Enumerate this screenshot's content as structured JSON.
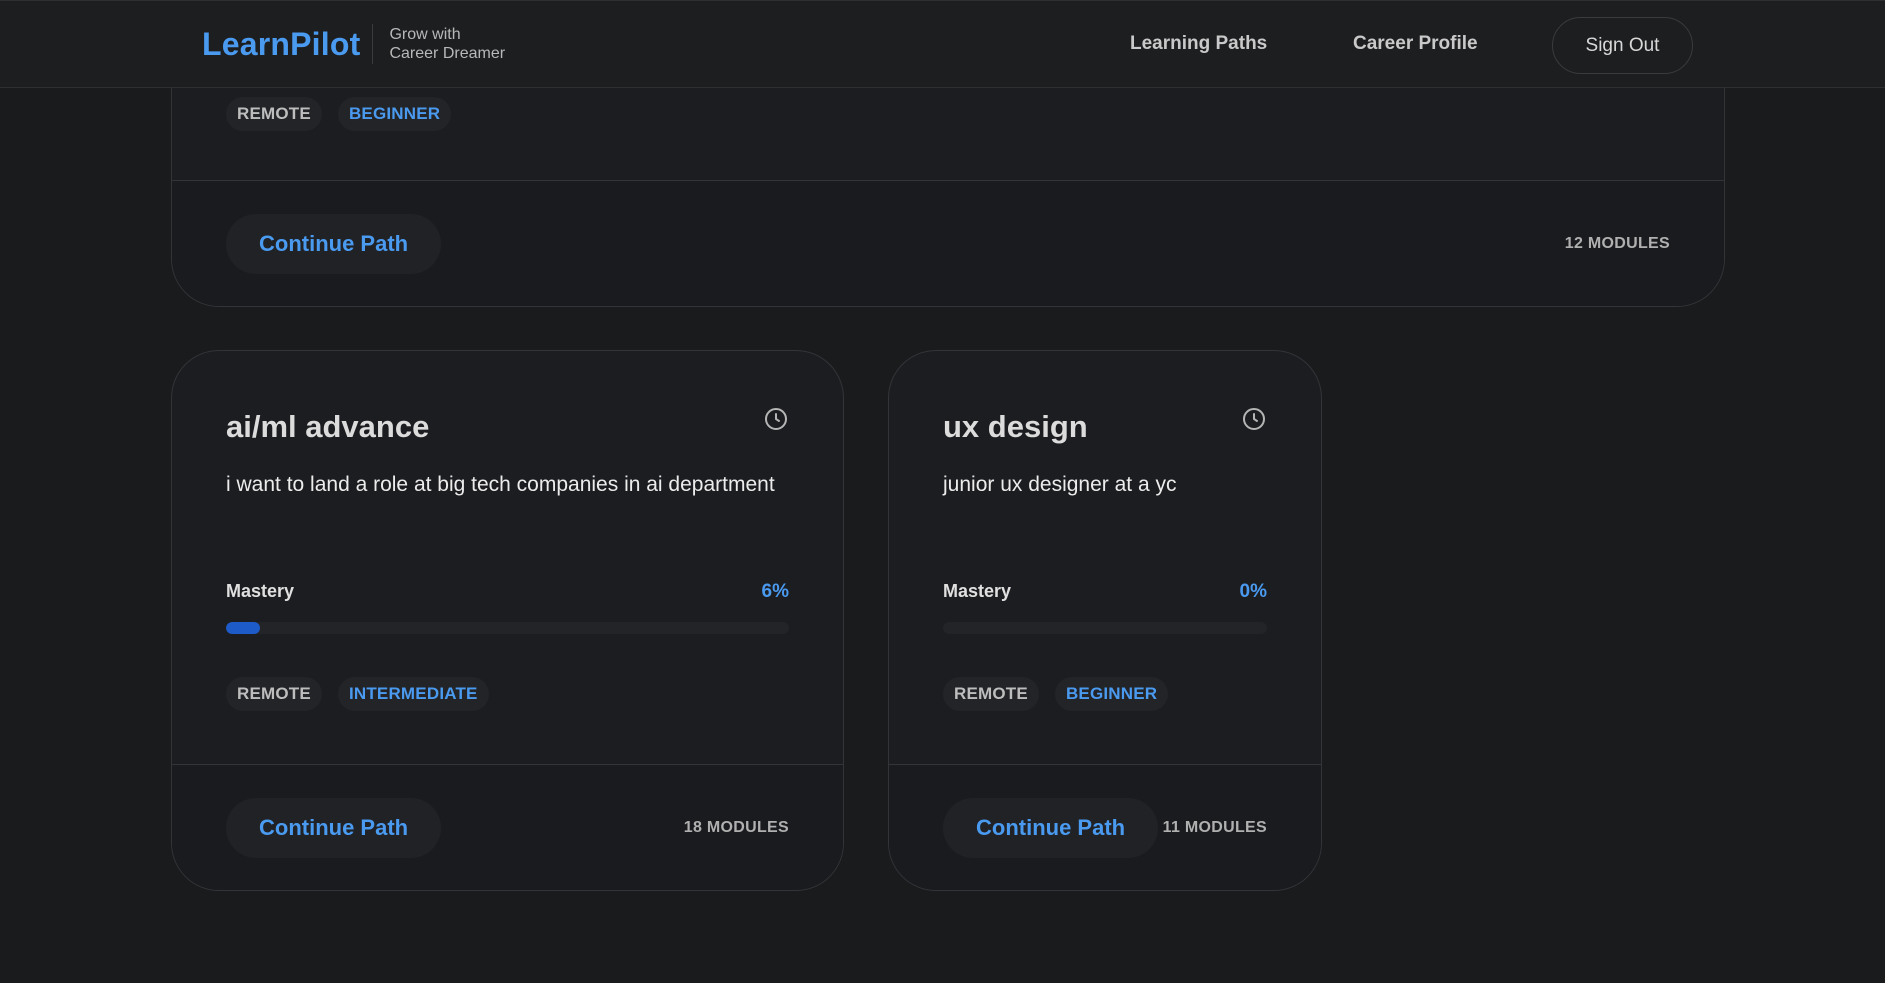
{
  "header": {
    "brand": "LearnPilot",
    "tagline_line1": "Grow with",
    "tagline_line2": "Career Dreamer",
    "nav": [
      "Learning Paths",
      "Career Profile"
    ],
    "sign_out": "Sign Out"
  },
  "cards": [
    {
      "tags": [
        "REMOTE",
        "BEGINNER"
      ],
      "cta": "Continue Path",
      "modules": "12 MODULES"
    },
    {
      "title": "ai/ml advance",
      "description": "i want to land a role at big tech companies in ai department",
      "mastery_label": "Mastery",
      "mastery_percent_text": "6%",
      "mastery_fraction": 0.06,
      "tags": [
        "REMOTE",
        "INTERMEDIATE"
      ],
      "cta": "Continue Path",
      "modules": "18 MODULES",
      "icon": "clock-icon"
    },
    {
      "title": "ux design",
      "description": "junior ux designer at a yc",
      "mastery_label": "Mastery",
      "mastery_percent_text": "0%",
      "mastery_fraction": 0.0,
      "tags": [
        "REMOTE",
        "BEGINNER"
      ],
      "cta": "Continue Path",
      "modules": "11 MODULES",
      "icon": "clock-icon"
    }
  ],
  "colors": {
    "accent": "#4a9af0",
    "progress_fill": "#1d5bc9",
    "background": "#1a1b1d"
  }
}
